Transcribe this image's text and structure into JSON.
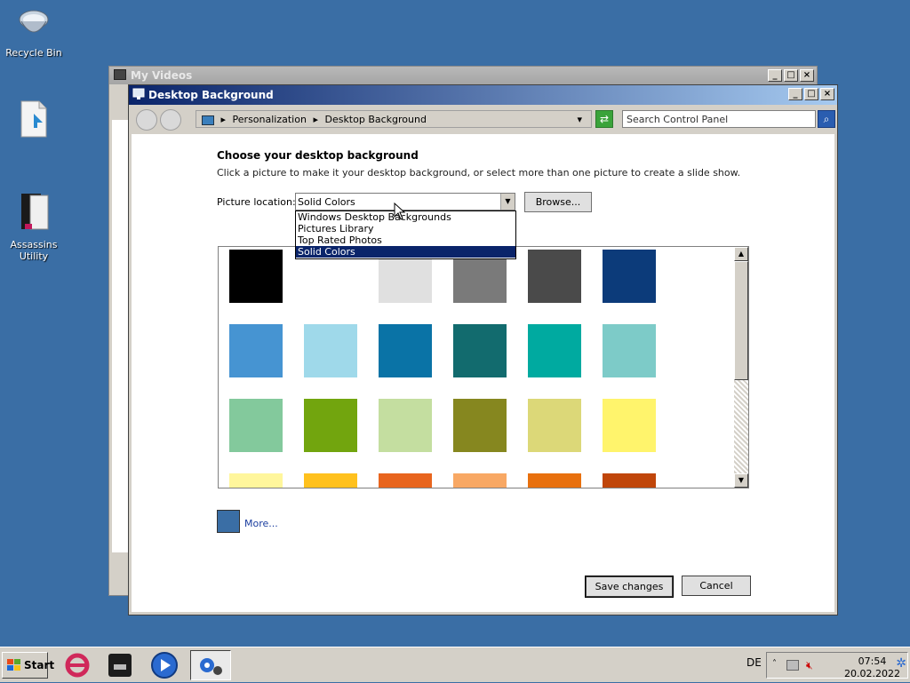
{
  "desktop": {
    "icons": [
      {
        "label": "Recycle Bin"
      },
      {
        "label": ""
      },
      {
        "label": "Assassins Utility"
      }
    ]
  },
  "back_window": {
    "title": "My Videos",
    "min": "_",
    "max": "□",
    "close": "×"
  },
  "window": {
    "title": "Desktop Background",
    "min": "_",
    "max": "□",
    "close": "×",
    "breadcrumb": [
      "Personalization",
      "Desktop Background"
    ],
    "search_placeholder": "Search Control Panel",
    "heading": "Choose your desktop background",
    "subtext": "Click a picture to make it your desktop background, or select more than one picture to create a slide show.",
    "location_label": "Picture location:",
    "location_value": "Solid Colors",
    "browse_label": "Browse...",
    "dropdown_options": [
      {
        "label": "Windows Desktop Backgrounds",
        "selected": false
      },
      {
        "label": "Pictures Library",
        "selected": false
      },
      {
        "label": "Top Rated Photos",
        "selected": false
      },
      {
        "label": "Solid Colors",
        "selected": true
      }
    ],
    "swatches": [
      [
        "#000000",
        "#ffffff",
        "#e0e0e0",
        "#7a7a7a",
        "#4a4a4a",
        "#0c3b7a"
      ],
      [
        "#4694d2",
        "#9fd9ea",
        "#0a73a6",
        "#126b6e",
        "#00aaa0",
        "#7dcbc8"
      ],
      [
        "#83c99c",
        "#72a50e",
        "#c4dea0",
        "#86871f",
        "#dcd878",
        "#fff46c"
      ],
      [
        "#fff69c",
        "#ffc11e",
        "#e8651e",
        "#f8a864",
        "#e8700e",
        "#c0460a"
      ]
    ],
    "more_label": "More...",
    "more_color": "#3a6ea5",
    "save_label": "Save changes",
    "cancel_label": "Cancel"
  },
  "taskbar": {
    "start_label": "Start",
    "language": "DE",
    "time": "07:54",
    "date": "20.02.2022"
  }
}
